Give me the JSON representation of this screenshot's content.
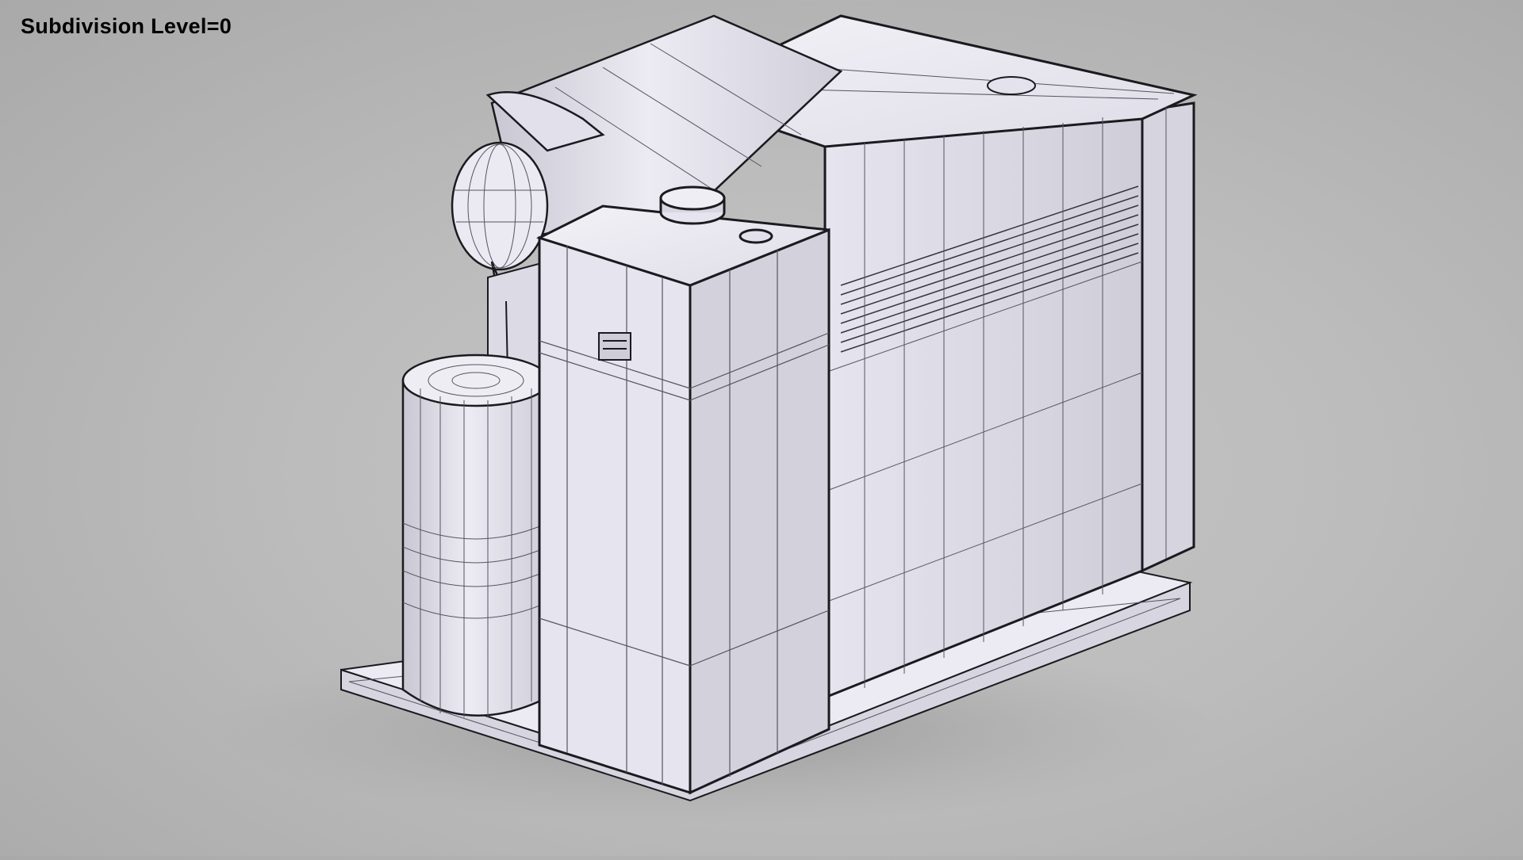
{
  "overlay": {
    "label": "Subdivision Level=0"
  },
  "scene": {
    "subject": "coffee-machine-wireframe",
    "colors": {
      "background": "#bdbdbd",
      "surface": "#eceaf2",
      "surface_shade": "#d4d2dc",
      "wire": "#555560",
      "edge": "#1a1a1f"
    }
  }
}
